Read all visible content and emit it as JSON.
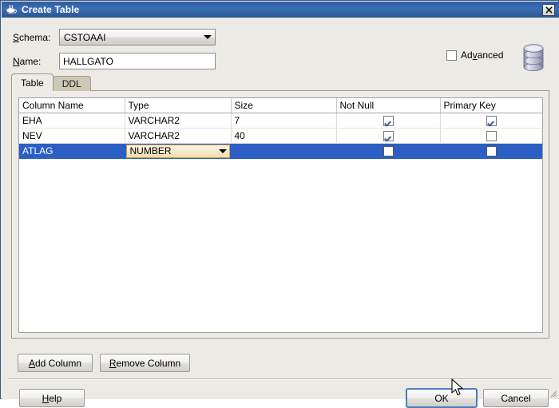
{
  "window": {
    "title": "Create Table",
    "icon": "java-coffee-cup-icon",
    "close_label": "✕"
  },
  "form": {
    "schema_label": "Schema:",
    "schema_label_mnemonic": "S",
    "schema_value": "CSTOAAI",
    "name_label": "Name:",
    "name_label_mnemonic": "N",
    "name_value": "HALLGATO",
    "name_placeholder": "",
    "advanced_label": "Advanced",
    "advanced_mnemonic": "v",
    "advanced_checked": false,
    "db_icon": "database-cylinder-icon"
  },
  "tabs": [
    {
      "label": "Table",
      "selected": true
    },
    {
      "label": "DDL",
      "selected": false
    }
  ],
  "grid": {
    "headers": [
      "Column Name",
      "Type",
      "Size",
      "Not Null",
      "Primary Key"
    ],
    "rows": [
      {
        "column_name": "EHA",
        "type": "VARCHAR2",
        "size": "7",
        "not_null": true,
        "primary_key": true,
        "selected": false,
        "editing_type": false
      },
      {
        "column_name": "NEV",
        "type": "VARCHAR2",
        "size": "40",
        "not_null": true,
        "primary_key": false,
        "selected": false,
        "editing_type": false
      },
      {
        "column_name": "ATLAG",
        "type": "NUMBER",
        "size": "",
        "not_null": false,
        "primary_key": false,
        "selected": true,
        "editing_type": true
      }
    ]
  },
  "buttons": {
    "add_column": "Add Column",
    "add_column_mnemonic": "A",
    "remove_column": "Remove Column",
    "remove_column_mnemonic": "R",
    "help": "Help",
    "help_mnemonic": "H",
    "ok": "OK",
    "cancel": "Cancel"
  },
  "colors": {
    "titlebar_start": "#2f5d9e",
    "titlebar_end": "#2a548f",
    "selection": "#2b5fc4",
    "dialog_bg": "#eceae4",
    "tab_unselected": "#cdc9b4",
    "editor_border": "#c99a4e",
    "focus_ring": "#4d7bbd"
  }
}
